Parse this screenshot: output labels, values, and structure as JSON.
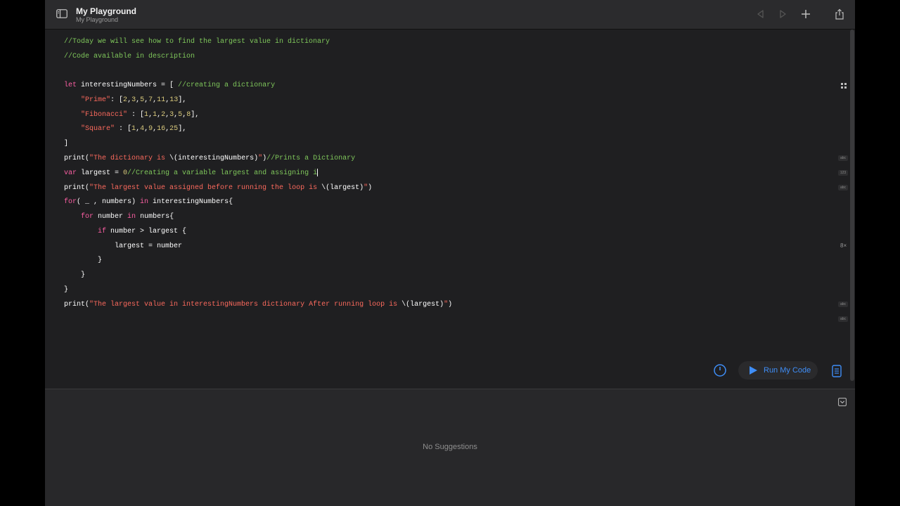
{
  "window": {
    "title": "My Playground",
    "subtitle": "My Playground"
  },
  "icons": {
    "sidebar_toggle": "sidebar-icon",
    "back": "back-triangle-icon",
    "forward": "forward-triangle-icon",
    "add": "plus-icon",
    "share": "share-icon",
    "timer": "timer-icon",
    "run": "play-icon",
    "docs": "document-icon",
    "collapse": "chevron-down-icon"
  },
  "code": {
    "l1_comment": "//Today we will see how to find the largest value in dictionary",
    "l2_comment": "//Code available in description",
    "l4_kw": "let",
    "l4_text": " interestingNumbers = [ ",
    "l4_comment": "//creating a dictionary",
    "l5_indent": "    ",
    "l5_key": "\"Prime\"",
    "l5_text1": ": [",
    "l5_n1": "2",
    "l5_n2": "3",
    "l5_n3": "5",
    "l5_n4": "7",
    "l5_n5": "11",
    "l5_n6": "13",
    "l5_end": "],",
    "l6_key": "\"Fibonacci\"",
    "l6_text1": " : [",
    "l6_n1": "1",
    "l6_n2": "1",
    "l6_n3": "2",
    "l6_n4": "3",
    "l6_n5": "5",
    "l6_n6": "8",
    "l6_end": "],",
    "l7_key": "\"Square\"",
    "l7_text1": " : [",
    "l7_n1": "1",
    "l7_n2": "4",
    "l7_n3": "9",
    "l7_n4": "16",
    "l7_n5": "25",
    "l7_end": "],",
    "l8": "]",
    "l9_fn": "print(",
    "l9_str": "\"The dictionary is ",
    "l9_interp": "\\(interestingNumbers)",
    "l9_strend": "\"",
    "l9_close": ")",
    "l9_comment": "//Prints a Dictionary",
    "l10_kw": "var",
    "l10_text": " largest = ",
    "l10_num": "0",
    "l10_comment": "//Creating a variable largest and assigning i",
    "l11_fn": "print(",
    "l11_str": "\"The largest value assigned before running the loop is ",
    "l11_interp": "\\(largest)",
    "l11_strend": "\"",
    "l11_close": ")",
    "l12_kw": "for",
    "l12_text1": "( _ , numbers) ",
    "l12_kw2": "in",
    "l12_text2": " interestingNumbers{",
    "l13_indent": "    ",
    "l13_kw": "for",
    "l13_text1": " number ",
    "l13_kw2": "in",
    "l13_text2": " numbers{",
    "l14_indent": "        ",
    "l14_kw": "if",
    "l14_text": " number > largest {",
    "l15": "            largest = number",
    "l16": "        }",
    "l17": "    }",
    "l18": "}",
    "l19_fn": "print(",
    "l19_str": "\"The largest value in interestingNumbers dictionary After running loop is ",
    "l19_interp": "\\(largest)",
    "l19_strend": "\"",
    "l19_close": ")"
  },
  "results": {
    "r9": "abc",
    "r10": "123",
    "r11": "abc",
    "r15": "8×",
    "r19": "abc",
    "r20": "abc"
  },
  "toolbar": {
    "run_label": "Run My Code"
  },
  "console": {
    "empty_text": "No Suggestions"
  },
  "colors": {
    "comment": "#7fc75b",
    "keyword": "#fc5fa3",
    "string": "#fc6a5d",
    "number": "#d9c97c",
    "accent": "#3f8ef7"
  }
}
